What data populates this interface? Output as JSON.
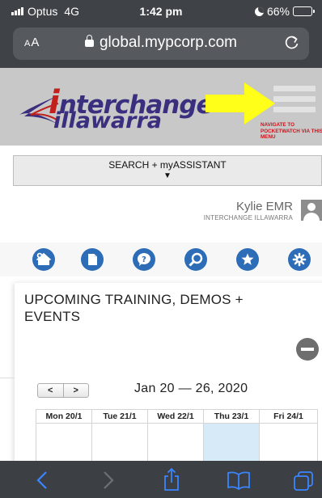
{
  "status": {
    "carrier": "Optus",
    "network": "4G",
    "time": "1:42 pm",
    "battery_percent": "66%",
    "battery_level": 0.66
  },
  "browser": {
    "aa_label_small": "A",
    "aa_label": "A",
    "url": "global.mypcorp.com"
  },
  "banner": {
    "logo_line1_first": "i",
    "logo_line1_rest": "nterchange",
    "logo_line2": "illawarra",
    "nav_note": "NAVIGATE TO POCKETWATCH VIA THIS MENU",
    "colors": {
      "logo_purple": "#3a2e7e",
      "logo_red": "#c2201d",
      "arrow_yellow": "#ffff19",
      "note_red": "#d0121b"
    }
  },
  "search": {
    "label": "SEARCH + myASSISTANT",
    "toggle_glyph": "▼"
  },
  "user": {
    "name": "Kylie EMR",
    "organisation": "INTERCHANGE ILLAWARRA"
  },
  "quick_icons": [
    "home-add-icon",
    "document-icon",
    "help-icon",
    "search-icon",
    "star-icon",
    "settings-icon"
  ],
  "events": {
    "title": "UPCOMING TRAINING, DEMOS + EVENTS",
    "prev_label": "<",
    "next_label": ">",
    "date_range": "Jan 20 — 26, 2020",
    "days": [
      "Mon 20/1",
      "Tue 21/1",
      "Wed 22/1",
      "Thu 23/1",
      "Fri 24/1"
    ],
    "today": "Thu 23/1"
  },
  "toolbar": [
    "back-icon",
    "forward-icon",
    "share-icon",
    "bookmarks-icon",
    "tabs-icon"
  ]
}
